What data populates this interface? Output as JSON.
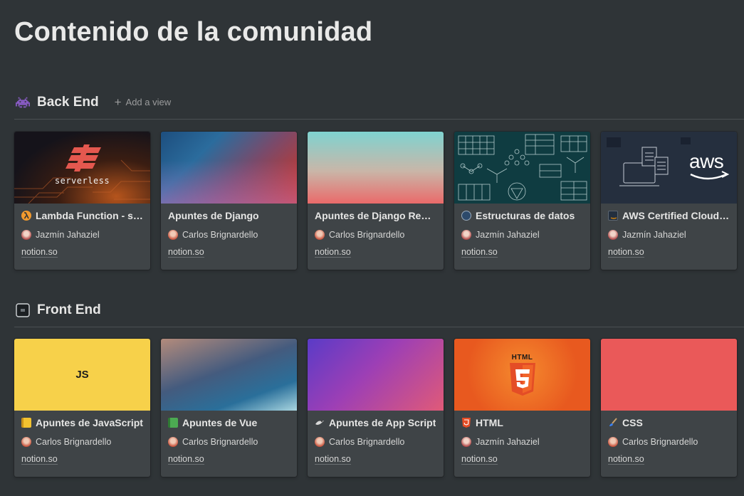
{
  "page": {
    "title": "Contenido de la comunidad"
  },
  "sections": [
    {
      "title": "Back End",
      "icon": "space-invader-icon",
      "add_view": "Add a view",
      "cards": [
        {
          "title": "Lambda Function - se...",
          "icon": "lambda-icon",
          "author": "Jazmín Jahaziel",
          "link": "notion.so",
          "cover_text": "serverless"
        },
        {
          "title": "Apuntes de Django",
          "icon": null,
          "author": "Carlos Brignardello",
          "link": "notion.so"
        },
        {
          "title": "Apuntes de Django Rest ...",
          "icon": null,
          "author": "Carlos Brignardello",
          "link": "notion.so"
        },
        {
          "title": "Estructuras de datos",
          "icon": "data-structure-icon",
          "author": "Jazmín Jahaziel",
          "link": "notion.so"
        },
        {
          "title": "AWS Certified Cloud ...",
          "icon": "aws-icon",
          "author": "Jazmín Jahaziel",
          "link": "notion.so",
          "cover_text": "aws"
        }
      ]
    },
    {
      "title": "Front End",
      "icon": "frontend-icon",
      "cards": [
        {
          "title": "Apuntes de JavaScript",
          "icon": "yellow-notebook-icon",
          "author": "Carlos Brignardello",
          "link": "notion.so",
          "cover_text": "JS"
        },
        {
          "title": "Apuntes de Vue",
          "icon": "green-book-icon",
          "author": "Carlos Brignardello",
          "link": "notion.so"
        },
        {
          "title": "Apuntes de App Script",
          "icon": "eagle-icon",
          "author": "Carlos Brignardello",
          "link": "notion.so"
        },
        {
          "title": "HTML",
          "icon": "html5-icon",
          "author": "Jazmín Jahaziel",
          "link": "notion.so",
          "cover_text": "HTML"
        },
        {
          "title": "CSS",
          "icon": "paintbrush-icon",
          "author": "Carlos Brignardello",
          "link": "notion.so"
        }
      ]
    }
  ],
  "colors": {
    "background": "#2f3437",
    "card": "#3f4447",
    "text": "#e6e6e5",
    "muted": "#9b9c9d"
  }
}
